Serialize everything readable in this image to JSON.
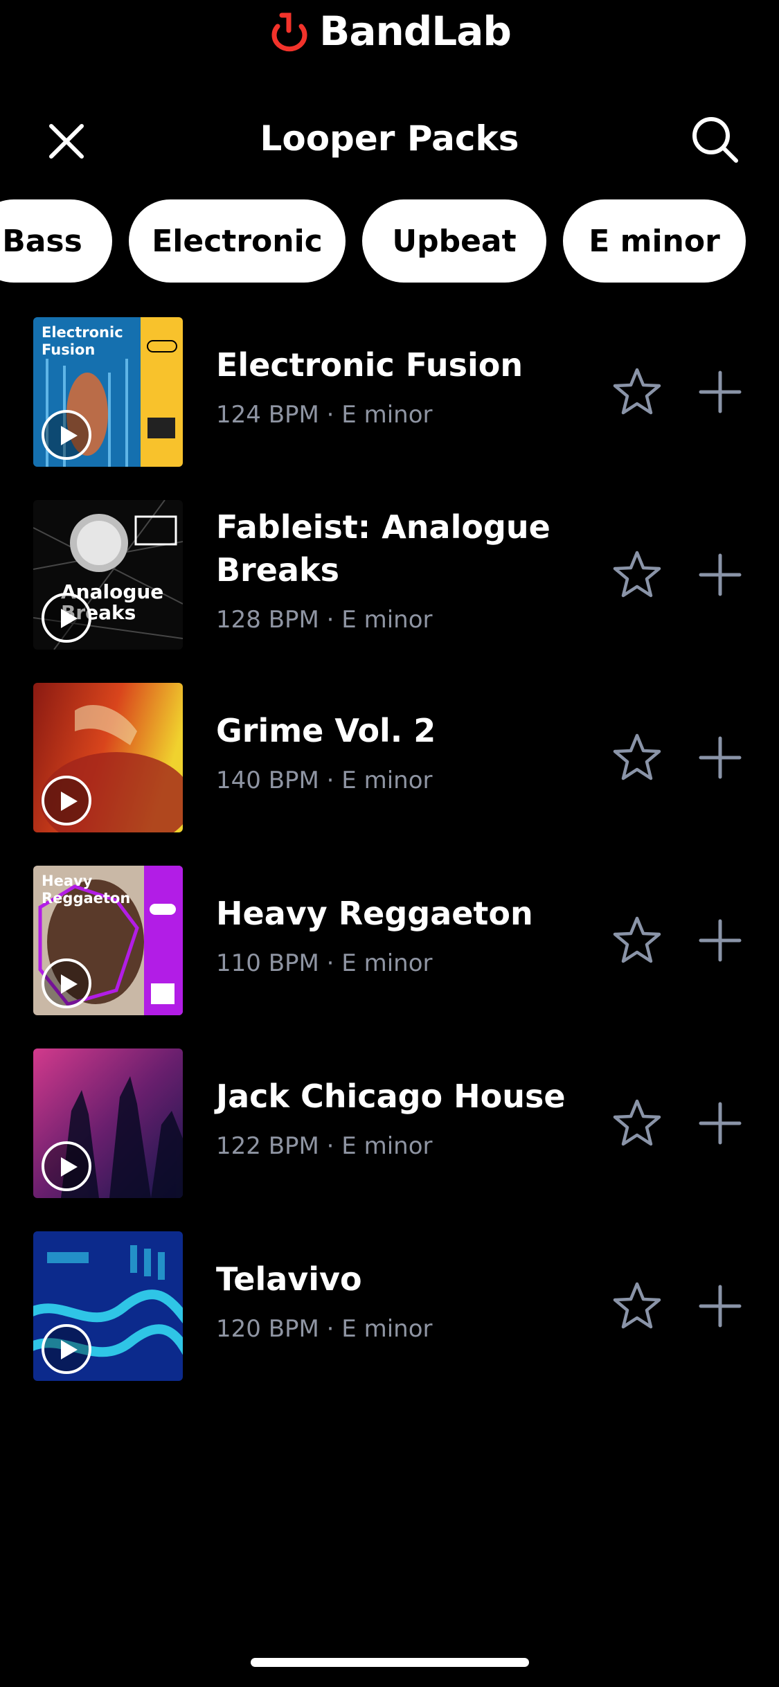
{
  "app": {
    "brand": "BandLab",
    "brand_icon": "bandlab-logo-icon",
    "accent_color": "#f2332b"
  },
  "header": {
    "title": "Looper Packs",
    "close_icon": "close-icon",
    "search_icon": "search-icon"
  },
  "filters": [
    "Bass",
    "Electronic",
    "Upbeat",
    "E minor"
  ],
  "packs": [
    {
      "title": "Electronic Fusion",
      "subtitle": "124 BPM · E minor",
      "art_text": "Electronic Fusion",
      "colors": [
        "#1a8fd6",
        "#f8c22c"
      ]
    },
    {
      "title": "Fableist: Analogue Breaks",
      "subtitle": "128 BPM · E minor",
      "art_text": "Analogue Breaks",
      "colors": [
        "#111111",
        "#dddddd"
      ]
    },
    {
      "title": "Grime Vol. 2",
      "subtitle": "140 BPM · E minor",
      "art_text": "",
      "colors": [
        "#c2241a",
        "#f0d22e"
      ]
    },
    {
      "title": "Heavy Reggaeton",
      "subtitle": "110 BPM · E minor",
      "art_text": "Heavy Reggaeton",
      "colors": [
        "#7a4a36",
        "#b21de6"
      ]
    },
    {
      "title": "Jack Chicago House",
      "subtitle": "122 BPM · E minor",
      "art_text": "",
      "colors": [
        "#b4287a",
        "#1a1b5e"
      ]
    },
    {
      "title": "Telavivo",
      "subtitle": "120 BPM · E minor",
      "art_text": "",
      "colors": [
        "#0c2a8c",
        "#33d6f0"
      ]
    }
  ],
  "row_icons": {
    "favorite": "star-outline-icon",
    "add": "plus-icon",
    "play": "play-icon"
  }
}
